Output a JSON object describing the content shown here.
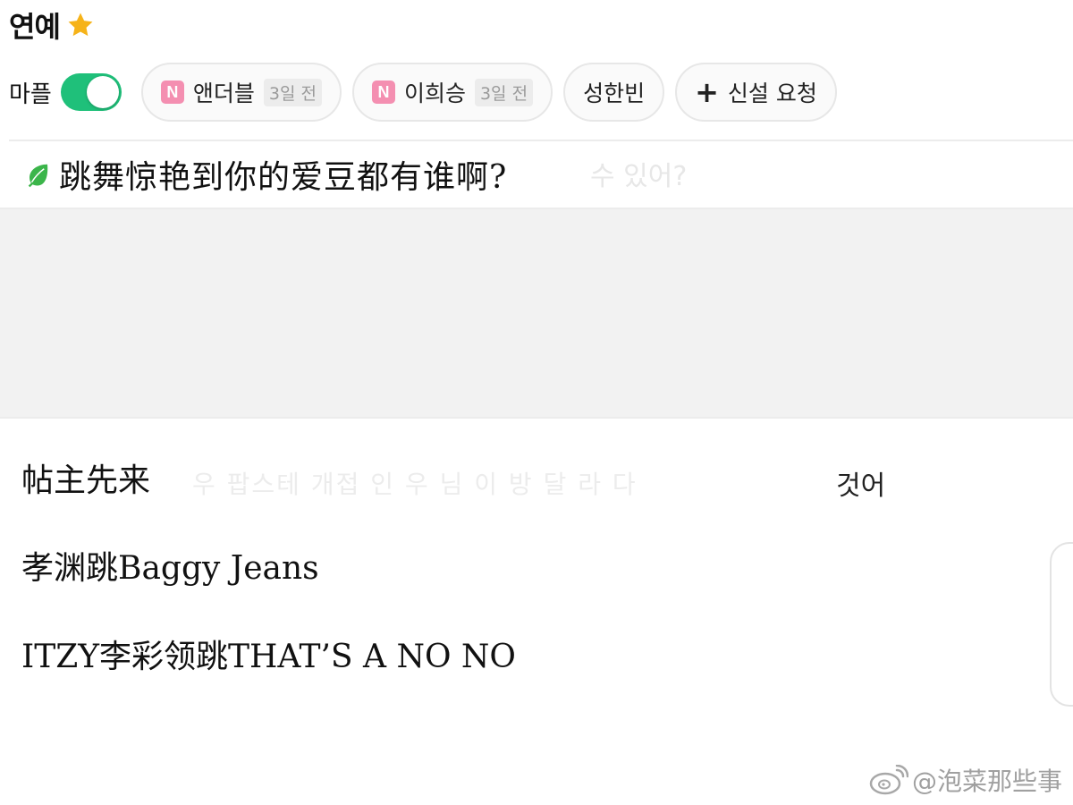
{
  "header": {
    "title": "연예",
    "star_icon": "star-icon"
  },
  "filter": {
    "toggle_label": "마플",
    "toggle_on": true,
    "chips": [
      {
        "badge": "N",
        "label": "앤더블",
        "age": "3일 전"
      },
      {
        "badge": "N",
        "label": "이희승",
        "age": "3일 전"
      },
      {
        "label": "성한빈"
      },
      {
        "plus": "+",
        "label": "신설 요청"
      }
    ]
  },
  "post": {
    "title": "跳舞惊艳到你的爱豆都有谁啊?",
    "ghost_title": "수 있어?"
  },
  "body": {
    "line1": "帖主先来",
    "line2": "孝渊跳Baggy Jeans",
    "line3": "ITZY李彩领跳THAT’S A NO NO",
    "ghost_text": "우 팝스테 개접 인 우 님 이 방 달 라 다",
    "ghost_word": "것어"
  },
  "watermark": {
    "text": "@泡菜那些事",
    "icon": "weibo-icon"
  },
  "colors": {
    "toggle": "#1fc07a",
    "badge": "#f48fb1",
    "star": "#f6b319",
    "leaf": "#3bb54a"
  }
}
